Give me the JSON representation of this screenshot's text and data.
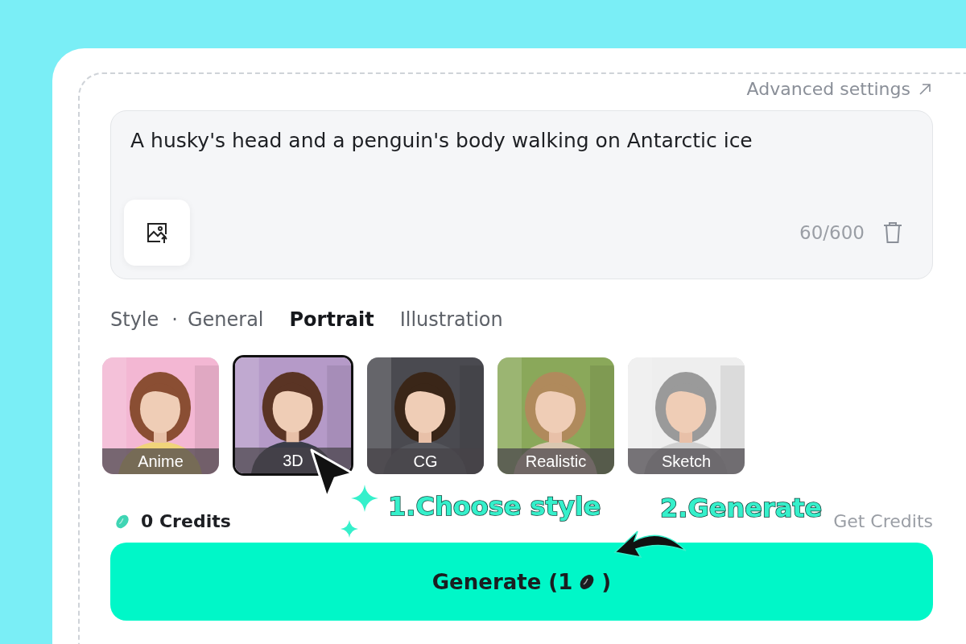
{
  "advanced_link": "Advanced settings",
  "prompt": {
    "value": "A husky's head and a penguin's body walking on Antarctic ice",
    "counter": "60/600"
  },
  "style": {
    "label": "Style",
    "separator": "·",
    "tabs": [
      {
        "label": "General",
        "selected": false
      },
      {
        "label": "Portrait",
        "selected": true
      },
      {
        "label": "Illustration",
        "selected": false
      }
    ]
  },
  "styles": [
    {
      "label": "Anime",
      "selected": false,
      "kind": "picture"
    },
    {
      "label": "3D",
      "selected": true,
      "kind": "picture"
    },
    {
      "label": "CG",
      "selected": false,
      "kind": "picture"
    },
    {
      "label": "Realistic",
      "selected": false,
      "kind": "picture"
    },
    {
      "label": "Sketch",
      "selected": false,
      "kind": "picture"
    }
  ],
  "credits": {
    "count": "0 Credits",
    "link": "Get Credits"
  },
  "generate_button": {
    "label": "Generate (1",
    "close": ")"
  },
  "annotations": [
    {
      "label": "1.Choose style"
    },
    {
      "label": "2.Generate"
    }
  ]
}
